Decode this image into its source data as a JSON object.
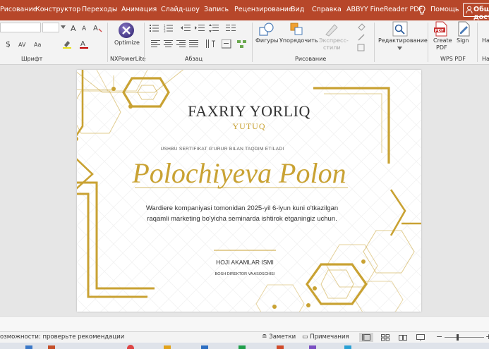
{
  "menu": {
    "items": [
      "Рисование",
      "Конструктор",
      "Переходы",
      "Анимация",
      "Слайд-шоу",
      "Запись",
      "Рецензирование",
      "Вид",
      "Справка",
      "ABBYY FineReader PDF"
    ],
    "help_label": "Помощь",
    "share_label": "Общий доступ"
  },
  "ribbon": {
    "groups": {
      "font": "Шрифт",
      "nxpowerlite": "NXPowerLite",
      "paragraph": "Абзац",
      "drawing": "Рисование",
      "wps_pdf": "WPS PDF"
    },
    "buttons": {
      "optimize": "Optimize",
      "shapes": "Фигуры",
      "arrange": "Упорядочить",
      "express_styles_1": "Экспресс-",
      "express_styles_2": "стили",
      "editing": "Редактирование",
      "create_pdf_1": "Create",
      "create_pdf_2": "PDF",
      "sign": "Sign",
      "next": "На"
    },
    "currency_symbol": "$"
  },
  "certificate": {
    "title": "FAXRIY YORLIQ",
    "subtitle": "YUTUQ",
    "presented_line": "USHBU SERTIFIKAT G'URUR BILAN TAQDIM ETILADI",
    "recipient": "Polochiyeva Polon",
    "description_line1": "Wardiere kompaniyasi tomonidan 2025-yil 6-iyun kuni o'tkazilgan",
    "description_line2": "raqamli marketing bo'yicha seminarda ishtirok etganingiz uchun.",
    "signer_name": "HOJI AKAMLAR ISMI",
    "signer_title": "BOSH DIREKTOR VA ASOSCHISI",
    "accent_color": "#c9a233",
    "text_color": "#333333"
  },
  "status": {
    "accessibility": "озможности: проверьте рекомендации",
    "notes_label": "Заметки",
    "comments_label": "Примечания"
  }
}
